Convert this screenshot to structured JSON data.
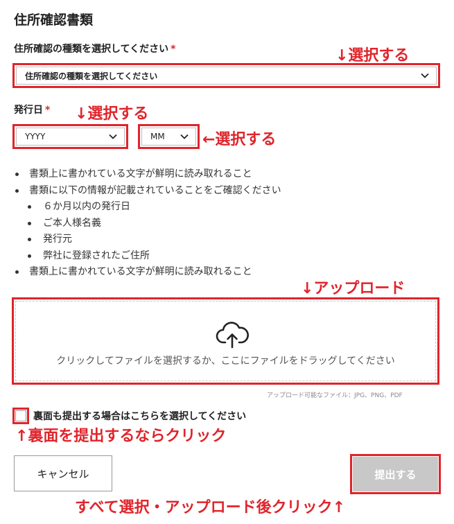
{
  "section_title": "住所確認書類",
  "doc_type": {
    "label": "住所確認の種類を選択してください",
    "required_mark": "*",
    "selected": "住所確認の種類を選択してください"
  },
  "issue_date": {
    "label": "発行日",
    "required_mark": "*",
    "year_selected": "YYYY",
    "month_selected": "MM"
  },
  "notes": [
    {
      "level": 1,
      "text": "書類上に書かれている文字が鮮明に読み取れること"
    },
    {
      "level": 1,
      "text": "書類に以下の情報が記載されていることをご確認ください"
    },
    {
      "level": 2,
      "text": "６か月以内の発行日"
    },
    {
      "level": 2,
      "text": "ご本人様名義"
    },
    {
      "level": 2,
      "text": "発行元"
    },
    {
      "level": 2,
      "text": "弊社に登録されたご住所"
    },
    {
      "level": 1,
      "text": "書類上に書かれている文字が鮮明に読み取れること"
    }
  ],
  "upload": {
    "icon": "cloud-upload-icon",
    "text": "クリックしてファイルを選択するか、ここにファイルをドラッグしてください",
    "file_hint": "アップロード可能なファイル：JPG、PNG、PDF"
  },
  "back_side": {
    "label": "裏面も提出する場合はこちらを選択してください",
    "checked": false
  },
  "buttons": {
    "cancel": "キャンセル",
    "submit": "提出する"
  },
  "annotations": {
    "select_doc": "↓選択する",
    "select_year": "↓選択する",
    "select_month": "←選択する",
    "upload": "↓アップロード",
    "back_side": "↑裏面を提出するならクリック",
    "submit": "すべて選択・アップロード後クリック↑"
  },
  "colors": {
    "annotation_red": "#e0242b",
    "submit_disabled": "#c8c8c8"
  }
}
